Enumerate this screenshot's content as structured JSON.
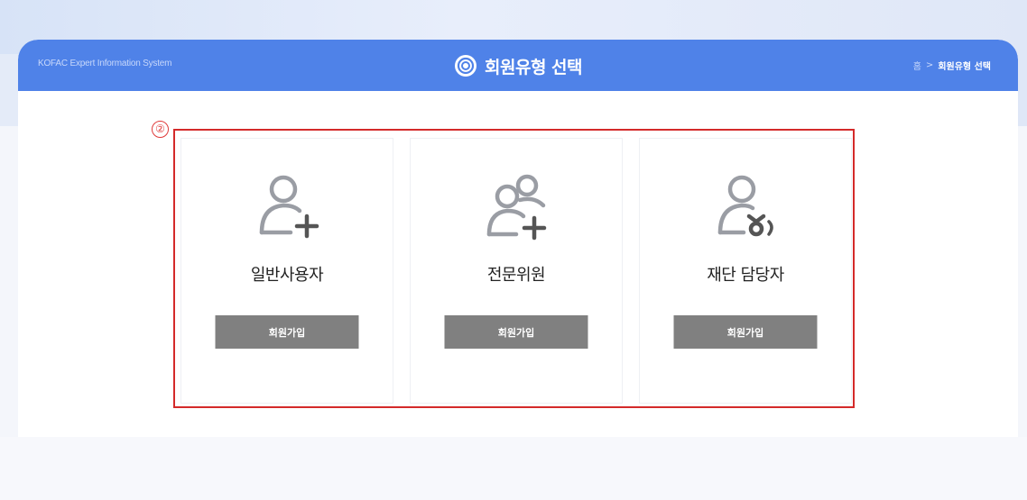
{
  "header": {
    "brand": "KOFAC Expert Information System",
    "title": "회원유형 선택",
    "breadcrumb": {
      "home": "홈",
      "separator": ">",
      "current": "회원유형 선택"
    }
  },
  "marker": {
    "label": "②"
  },
  "cards": [
    {
      "title": "일반사용자",
      "button": "회원가입",
      "icon": "user-add-icon"
    },
    {
      "title": "전문위원",
      "button": "회원가입",
      "icon": "users-add-icon"
    },
    {
      "title": "재단 담당자",
      "button": "회원가입",
      "icon": "user-manager-icon"
    }
  ],
  "colors": {
    "header": "#4f82e8",
    "button": "#808080",
    "highlight": "#d42a2a",
    "icon": "#999ca3",
    "icon_plus": "#555555"
  }
}
